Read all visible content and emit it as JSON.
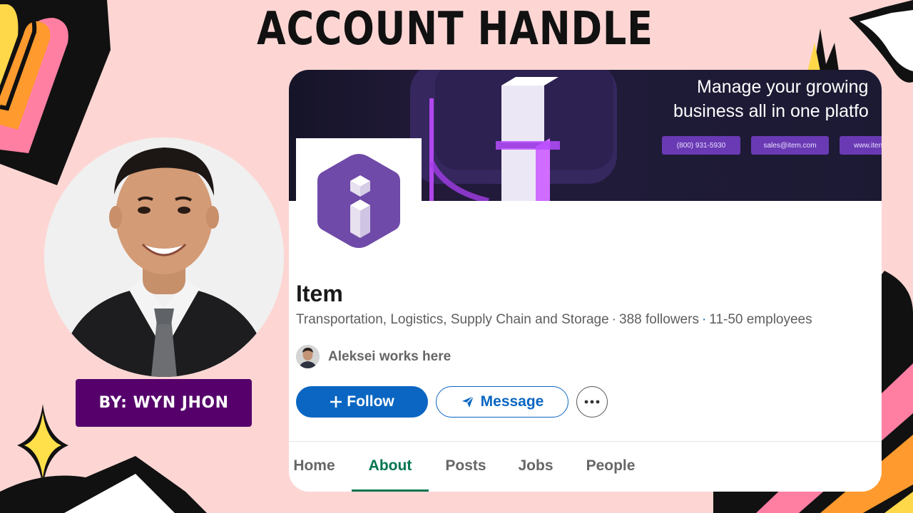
{
  "slide": {
    "title": "ACCOUNT HANDLE",
    "author_badge": "BY: WYN JHON"
  },
  "banner": {
    "headline_line1": "Manage your growing",
    "headline_line2": "business all in one platfo",
    "phone": "(800) 931-5930",
    "email": "sales@item.com",
    "website": "www.iten"
  },
  "company": {
    "name": "Item",
    "industry": "Transportation, Logistics, Supply Chain and Storage",
    "followers": "388 followers",
    "employees": "11-50 employees",
    "connection_text": "Aleksei works here"
  },
  "actions": {
    "follow_label": "Follow",
    "message_label": "Message"
  },
  "tabs": [
    {
      "label": "Home",
      "active": false
    },
    {
      "label": "About",
      "active": true
    },
    {
      "label": "Posts",
      "active": false
    },
    {
      "label": "Jobs",
      "active": false
    },
    {
      "label": "People",
      "active": false
    }
  ],
  "colors": {
    "background": "#fdd6d4",
    "badge": "#55006b",
    "linkedin_blue": "#0a66c2",
    "active_tab": "#01754f",
    "logo_purple": "#6f4aa8"
  },
  "icons": {
    "plus": "plus-icon",
    "message": "send-icon",
    "more": "ellipsis-icon",
    "logo": "item-logo-icon"
  }
}
